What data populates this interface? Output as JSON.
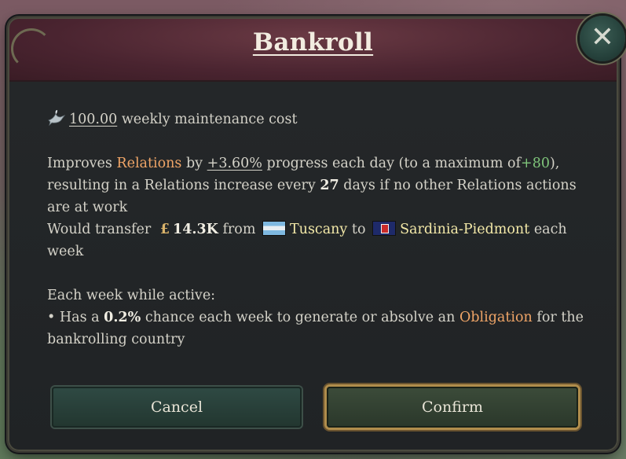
{
  "dialog": {
    "title": "Bankroll",
    "close_icon": "close-icon",
    "maintenance": {
      "icon": "dove-icon",
      "amount": "100.00",
      "label": "weekly maintenance cost"
    },
    "effect": {
      "t1": "Improves",
      "relations": "Relations",
      "t2": "by",
      "percent": "+3.60%",
      "t3": "progress each day  (to a maximum of",
      "max": "+80",
      "t4": "),",
      "t5": "resulting in a Relations increase every",
      "days": "27",
      "t6": "days if no other Relations actions are at work"
    },
    "transfer": {
      "t1": "Would transfer",
      "currency_icon": "pound-icon",
      "amount": "14.3K",
      "t2": "from",
      "from_country": "Tuscany",
      "t3": "to",
      "to_country": "Sardinia-Piedmont",
      "t4": "each week"
    },
    "weekly": {
      "heading": "Each week while active:",
      "bullet": "•",
      "t1": "Has a",
      "chance": "0.2%",
      "t2": "chance each week to generate or absolve an",
      "obligation": "Obligation",
      "t3": "for the bankrolling country"
    },
    "buttons": {
      "cancel": "Cancel",
      "confirm": "Confirm"
    }
  },
  "colors": {
    "header": "#4a2430",
    "panel": "#23262a",
    "orange_highlight": "#f0a567",
    "green_highlight": "#7fc47a",
    "country_name": "#f3e9a8",
    "confirm_border": "#b08d4c"
  }
}
